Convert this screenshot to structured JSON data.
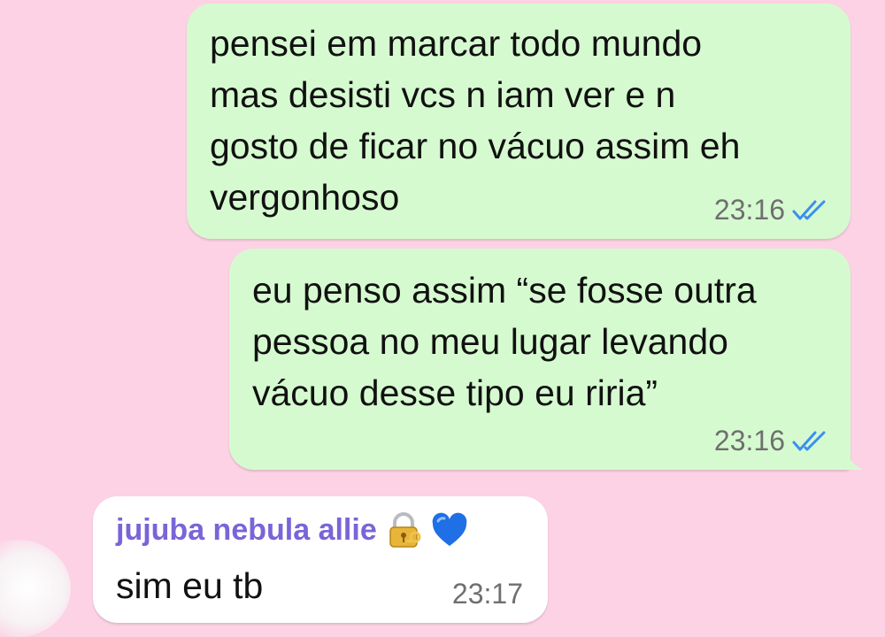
{
  "messages": [
    {
      "direction": "outgoing",
      "text": "pensei em marcar todo mundo\nmas desisti vcs n iam ver e n\ngosto de ficar no vácuo assim eh\nvergonhoso",
      "time": "23:16",
      "status_icon": "double-check-read-icon"
    },
    {
      "direction": "outgoing",
      "text": "eu penso assim “se fosse outra\npessoa no meu lugar levando\nvácuo desse tipo eu riria”",
      "time": "23:16",
      "status_icon": "double-check-read-icon"
    },
    {
      "direction": "incoming",
      "sender": "jujuba nebula allie",
      "sender_emojis": [
        "lock-with-key-icon",
        "blue-heart-icon"
      ],
      "text": "sim eu tb",
      "time": "23:17"
    }
  ],
  "colors": {
    "background": "#fcd2e4",
    "outgoing_bubble": "#d6fad0",
    "incoming_bubble": "#ffffff",
    "read_ticks": "#3a8ff0",
    "sender_name": "#7a64d8",
    "timestamp": "#6f6f6f"
  }
}
